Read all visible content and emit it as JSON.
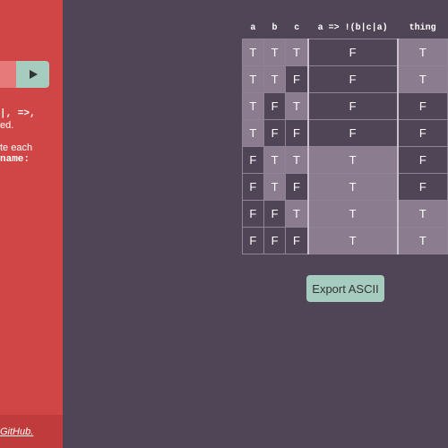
{
  "sidebar": {
    "input_value": "",
    "run_icon": "play-icon",
    "help_lines": [
      {
        "text": "|, =>,",
        "mono": true
      },
      {
        "text": "ed.",
        "mono": false
      },
      {
        "text": "te each",
        "mono": false
      },
      {
        "text": "name:",
        "mono": true
      }
    ],
    "footer_link": "GitHub."
  },
  "table": {
    "headers": [
      "a",
      "b",
      "c",
      "a => !(b|c|a)",
      "thing"
    ],
    "rows": [
      [
        "T",
        "T",
        "T",
        "F",
        "T"
      ],
      [
        "T",
        "T",
        "F",
        "F",
        "T"
      ],
      [
        "T",
        "F",
        "T",
        "F",
        "F"
      ],
      [
        "T",
        "F",
        "F",
        "F",
        "F"
      ],
      [
        "F",
        "T",
        "T",
        "T",
        "F"
      ],
      [
        "F",
        "T",
        "F",
        "T",
        "F"
      ],
      [
        "F",
        "F",
        "T",
        "T",
        "T"
      ],
      [
        "F",
        "F",
        "F",
        "T",
        "T"
      ]
    ]
  },
  "export_label": "Export ASCII",
  "colors": {
    "background": "#4f4557",
    "sidebar": "#d04545",
    "accent": "#a6ccbf",
    "true_cell": "#8b7c8f"
  }
}
